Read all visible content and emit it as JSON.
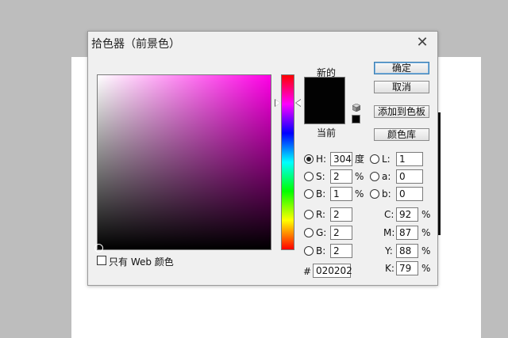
{
  "dialog": {
    "title": "拾色器（前景色）",
    "close_glyph": "✕"
  },
  "preview": {
    "new_label": "新的",
    "current_label": "当前",
    "new_color": "#020202",
    "current_color": "#020202"
  },
  "buttons": {
    "ok": "确定",
    "cancel": "取消",
    "add_to_swatches": "添加到色板",
    "color_libraries": "颜色库"
  },
  "hsb": {
    "h": {
      "label": "H:",
      "value": "304",
      "unit": "度"
    },
    "s": {
      "label": "S:",
      "value": "2",
      "unit": "%"
    },
    "b": {
      "label": "B:",
      "value": "1",
      "unit": "%"
    }
  },
  "lab": {
    "l": {
      "label": "L:",
      "value": "1"
    },
    "a": {
      "label": "a:",
      "value": "0"
    },
    "b": {
      "label": "b:",
      "value": "0"
    }
  },
  "rgb": {
    "r": {
      "label": "R:",
      "value": "2"
    },
    "g": {
      "label": "G:",
      "value": "2"
    },
    "b": {
      "label": "B:",
      "value": "2"
    }
  },
  "cmyk": {
    "c": {
      "label": "C:",
      "value": "92",
      "unit": "%"
    },
    "m": {
      "label": "M:",
      "value": "87",
      "unit": "%"
    },
    "y": {
      "label": "Y:",
      "value": "88",
      "unit": "%"
    },
    "k": {
      "label": "K:",
      "value": "79",
      "unit": "%"
    }
  },
  "hex": {
    "label": "#",
    "value": "020202"
  },
  "web_only": {
    "label": "只有 Web 颜色",
    "checked": false
  },
  "colors": {
    "hue_color": "#ff00e6",
    "ok_border": "#3c7fb1"
  }
}
